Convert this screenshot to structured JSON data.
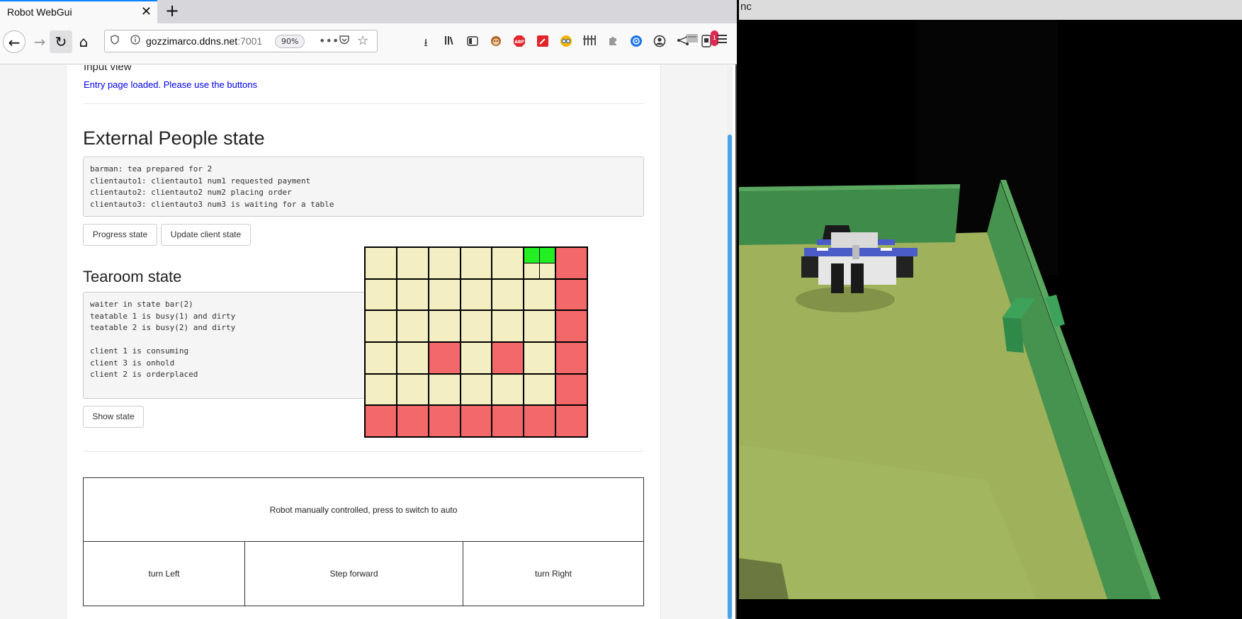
{
  "browser": {
    "tab_title": "Robot WebGui",
    "tab_close": "✕",
    "new_tab": "+",
    "url_host": "gozzimarco.ddns.net",
    "url_port": ":7001",
    "zoom": "90%",
    "more": "•••",
    "nav": {
      "back": "←",
      "forward": "→",
      "reload": "↻",
      "home": "⌂"
    },
    "toolbar_icons": [
      "download-icon",
      "library-icon",
      "sidebar-icon",
      "monkey-extension-icon",
      "adblock-icon",
      "color-picker-icon",
      "glasses-extension-icon",
      "bars-icon",
      "puzzle-icon",
      "reload-extension-icon",
      "account-icon",
      "share-icon",
      "notification-extension-icon",
      "window-icon",
      "hamburger-menu-icon"
    ],
    "notification_badge": "1"
  },
  "page": {
    "input_view": {
      "heading": "Input view",
      "message": "Entry page loaded. Please use the buttons"
    },
    "external_people": {
      "title": "External People state",
      "state_text": "barman: tea prepared for 2\nclientauto1: clientauto1 num1 requested payment\nclientauto2: clientauto2 num2 placing order\nclientauto3: clientauto3 num3 is waiting for a table",
      "progress_button": "Progress state",
      "update_button": "Update client state"
    },
    "tearoom": {
      "title": "Tearoom state",
      "state_text": "waiter in state bar(2)\nteatable 1 is busy(1) and dirty\nteatable 2 is busy(2) and dirty\n\nclient 1 is consuming\nclient 3 is onhold\nclient 2 is orderplaced",
      "show_button": "Show state"
    },
    "map": {
      "cols": 7,
      "rows": 6,
      "colors": {
        "free": "#f3efc3",
        "obstacle": "#f36868",
        "robot": "#22ee22"
      },
      "cells": [
        [
          "free",
          "free",
          "free",
          "free",
          "free",
          "robot",
          "obstacle"
        ],
        [
          "free",
          "free",
          "free",
          "free",
          "free",
          "free",
          "obstacle"
        ],
        [
          "free",
          "free",
          "free",
          "free",
          "free",
          "free",
          "obstacle"
        ],
        [
          "free",
          "free",
          "obstacle",
          "free",
          "obstacle",
          "free",
          "obstacle"
        ],
        [
          "free",
          "free",
          "free",
          "free",
          "free",
          "free",
          "obstacle"
        ],
        [
          "obstacle",
          "obstacle",
          "obstacle",
          "obstacle",
          "obstacle",
          "obstacle",
          "obstacle"
        ]
      ]
    },
    "robot_control": {
      "auto_button": "Robot manually controlled, press to switch to auto",
      "left_button": "turn Left",
      "forward_button": "Step forward",
      "right_button": "turn Right"
    }
  },
  "scene": {
    "window_label": "nc"
  }
}
